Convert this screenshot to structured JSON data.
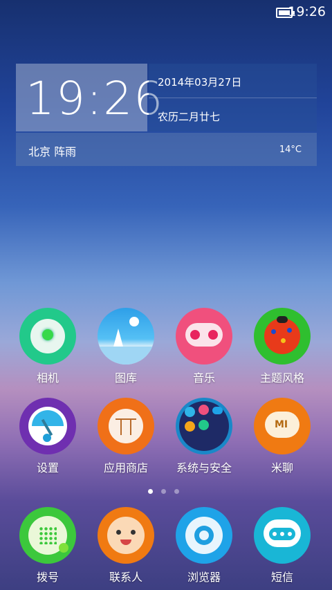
{
  "status_bar": {
    "time": "19:26"
  },
  "widget": {
    "clock": "19:26",
    "date": "2014年03月27日",
    "lunar_date": "农历二月廿七",
    "weather": "北京 阵雨",
    "temperature": "14°C"
  },
  "apps_row1": [
    {
      "label": "相机",
      "icon": "camera-icon"
    },
    {
      "label": "图库",
      "icon": "gallery-icon"
    },
    {
      "label": "音乐",
      "icon": "music-icon"
    },
    {
      "label": "主题风格",
      "icon": "theme-icon"
    }
  ],
  "apps_row2": [
    {
      "label": "设置",
      "icon": "settings-icon"
    },
    {
      "label": "应用商店",
      "icon": "app-store-icon"
    },
    {
      "label": "系统与安全",
      "icon": "security-icon"
    },
    {
      "label": "米聊",
      "icon": "miliao-icon"
    }
  ],
  "dock": [
    {
      "label": "拨号",
      "icon": "dialer-icon"
    },
    {
      "label": "联系人",
      "icon": "contacts-icon"
    },
    {
      "label": "浏览器",
      "icon": "browser-icon"
    },
    {
      "label": "短信",
      "icon": "messages-icon"
    }
  ],
  "page_indicator": {
    "pages": 3,
    "current": 1
  },
  "colors": {
    "camera": "#22c98a",
    "gallery": "#3fb0f0",
    "music": "#f0507d",
    "theme": "#2fbf2f",
    "settings": "#6f2fb0",
    "store": "#f07018",
    "security": "#1a88c8",
    "miliao": "#f07a12",
    "dialer": "#3cc83c",
    "contacts": "#f07a12",
    "browser": "#1fa3e8",
    "messages": "#19b6d6"
  }
}
